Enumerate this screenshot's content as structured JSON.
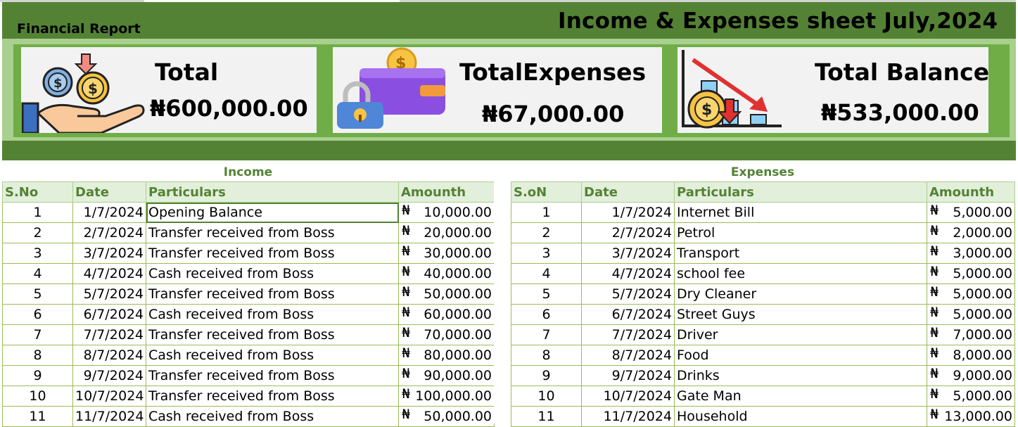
{
  "header": {
    "report_label": "Financial Report",
    "title": "Income & Expenses sheet July,2024"
  },
  "summary": {
    "income": {
      "label": "Total",
      "value": "₦600,000.00",
      "icon": "money-hand-icon"
    },
    "expenses": {
      "label": "TotalExpenses",
      "value": "₦67,000.00",
      "icon": "wallet-lock-icon"
    },
    "balance": {
      "label": "Total Balance",
      "value": "₦533,000.00",
      "icon": "declining-coin-icon"
    }
  },
  "income": {
    "title": "Income",
    "columns": [
      "S.No",
      "Date",
      "Particulars",
      "Amounth"
    ],
    "rows": [
      {
        "no": "1",
        "date": "1/7/2024",
        "particulars": "Opening Balance",
        "cur": "₦",
        "amount": "10,000.00"
      },
      {
        "no": "2",
        "date": "2/7/2024",
        "particulars": "Transfer received from Boss",
        "cur": "₦",
        "amount": "20,000.00"
      },
      {
        "no": "3",
        "date": "3/7/2024",
        "particulars": "Transfer received from Boss",
        "cur": "₦",
        "amount": "30,000.00"
      },
      {
        "no": "4",
        "date": "4/7/2024",
        "particulars": "Cash received from Boss",
        "cur": "₦",
        "amount": "40,000.00"
      },
      {
        "no": "5",
        "date": "5/7/2024",
        "particulars": "Transfer received from Boss",
        "cur": "₦",
        "amount": "50,000.00"
      },
      {
        "no": "6",
        "date": "6/7/2024",
        "particulars": "Cash received from Boss",
        "cur": "₦",
        "amount": "60,000.00"
      },
      {
        "no": "7",
        "date": "7/7/2024",
        "particulars": "Transfer received from Boss",
        "cur": "₦",
        "amount": "70,000.00"
      },
      {
        "no": "8",
        "date": "8/7/2024",
        "particulars": "Cash received from Boss",
        "cur": "₦",
        "amount": "80,000.00"
      },
      {
        "no": "9",
        "date": "9/7/2024",
        "particulars": "Transfer received from Boss",
        "cur": "₦",
        "amount": "90,000.00"
      },
      {
        "no": "10",
        "date": "10/7/2024",
        "particulars": "Transfer received from Boss",
        "cur": "₦",
        "amount": "100,000.00"
      },
      {
        "no": "11",
        "date": "11/7/2024",
        "particulars": "Cash received from Boss",
        "cur": "₦",
        "amount": "50,000.00"
      }
    ]
  },
  "expenses": {
    "title": "Expenses",
    "columns": [
      "S.oN",
      "Date",
      "Particulars",
      "Amounth"
    ],
    "rows": [
      {
        "no": "1",
        "date": "1/7/2024",
        "particulars": "Internet Bill",
        "cur": "₦",
        "amount": "5,000.00"
      },
      {
        "no": "2",
        "date": "2/7/2024",
        "particulars": "Petrol",
        "cur": "₦",
        "amount": "2,000.00"
      },
      {
        "no": "3",
        "date": "3/7/2024",
        "particulars": "Transport",
        "cur": "₦",
        "amount": "3,000.00"
      },
      {
        "no": "4",
        "date": "4/7/2024",
        "particulars": "school fee",
        "cur": "₦",
        "amount": "5,000.00"
      },
      {
        "no": "5",
        "date": "5/7/2024",
        "particulars": "Dry Cleaner",
        "cur": "₦",
        "amount": "5,000.00"
      },
      {
        "no": "6",
        "date": "6/7/2024",
        "particulars": "Street Guys",
        "cur": "₦",
        "amount": "5,000.00"
      },
      {
        "no": "7",
        "date": "7/7/2024",
        "particulars": "Driver",
        "cur": "₦",
        "amount": "7,000.00"
      },
      {
        "no": "8",
        "date": "8/7/2024",
        "particulars": "Food",
        "cur": "₦",
        "amount": "8,000.00"
      },
      {
        "no": "9",
        "date": "9/7/2024",
        "particulars": "Drinks",
        "cur": "₦",
        "amount": "9,000.00"
      },
      {
        "no": "10",
        "date": "10/7/2024",
        "particulars": "Gate Man",
        "cur": "₦",
        "amount": "5,000.00"
      },
      {
        "no": "11",
        "date": "11/7/2024",
        "particulars": "Household",
        "cur": "₦",
        "amount": "13,000.00"
      }
    ]
  },
  "colors": {
    "dark_green": "#548235",
    "mid_green": "#70ad47",
    "light_green": "#a9d08e",
    "header_fill": "#e2efda"
  }
}
